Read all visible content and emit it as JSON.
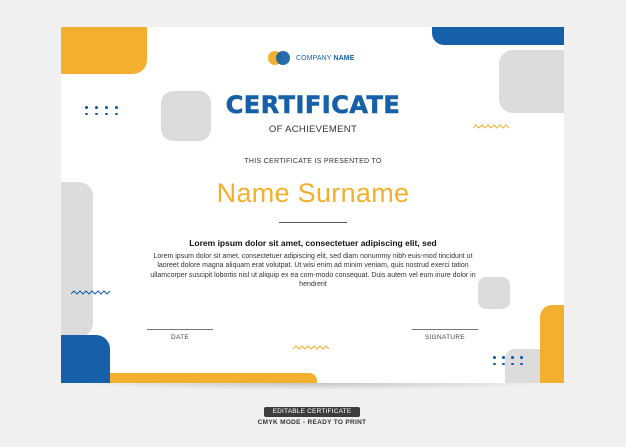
{
  "certificate": {
    "company_name_prefix": "COMPANY ",
    "company_name_bold": "NAME",
    "title": "CERTIFICATE",
    "subtitle": "OF ACHIEVEMENT",
    "presented_to": "THIS CERTIFICATE IS PRESENTED TO",
    "recipient_name": "Name Surname",
    "lead_text": "Lorem ipsum dolor sit amet, consectetuer adipiscing elit, sed",
    "body_text": "Lorem ipsum dolor sit amet, consectetuer adipiscing elit, sed diam nonummy nibh euis-mod tincidunt ut laoreet dolore magna aliquam erat volutpat. Ut wisi enim ad minim veniam, quis nostrud exerci tation ullamcorper suscipit lobortis nisl ut aliquip ex ea com-modo consequat. Duis autem vel eum iriure dolor in hendrerit",
    "date_label": "DATE",
    "signature_label": "SIGNATURE"
  },
  "footer": {
    "badge": "EDITABLE CERTIFICATE",
    "subtitle": "CMYK MODE - READY TO PRINT"
  },
  "colors": {
    "accent_blue": "#1560a8",
    "accent_yellow": "#f3b02e",
    "shape_grey": "#dcdcdc"
  }
}
